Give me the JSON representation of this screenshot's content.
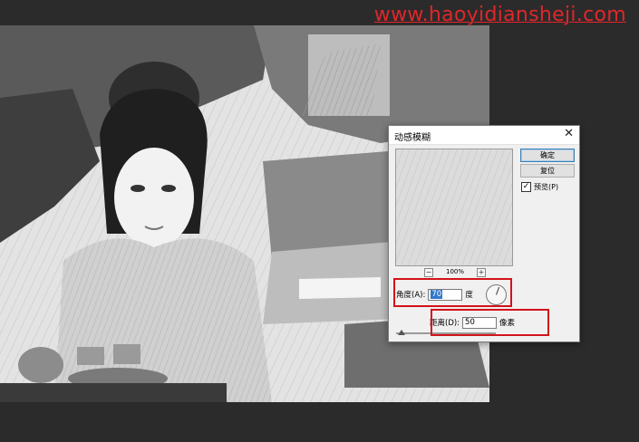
{
  "watermark": {
    "text": "www.haoyidiansheji.com"
  },
  "dialog": {
    "title": "动感模糊",
    "zoom_minus": "−",
    "zoom_plus": "+",
    "zoom_level": "100%",
    "ok_label": "确定",
    "reset_label": "复位",
    "preview_label": "预览(P)",
    "preview_checked": true,
    "angle_label": "角度(A):",
    "angle_value": "70",
    "angle_unit": "度",
    "distance_label": "距离(D):",
    "distance_value": "50",
    "distance_unit": "像素",
    "distance_slider_fraction": 0.05
  },
  "colors": {
    "highlight": "#d3121a",
    "watermark": "#e0262b",
    "accent": "#3c7fb1"
  }
}
